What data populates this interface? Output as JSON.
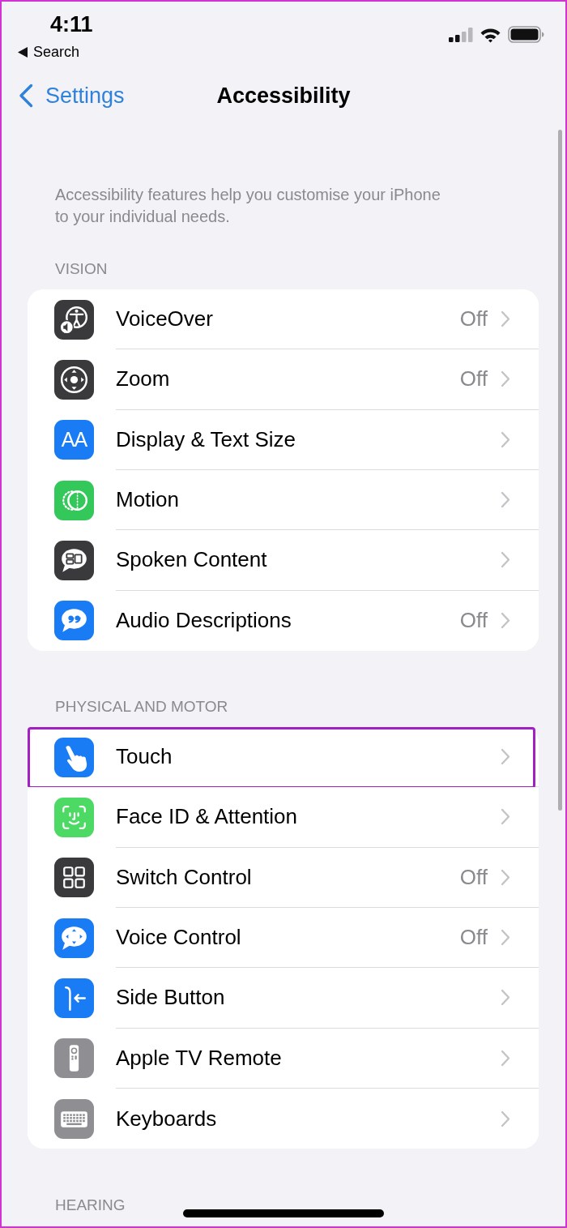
{
  "status_bar": {
    "time": "4:11",
    "back_app": "Search"
  },
  "nav_bar": {
    "back_label": "Settings",
    "title": "Accessibility"
  },
  "intro": "Accessibility features help you customise your iPhone\nto your individual needs.",
  "sections": [
    {
      "header": "VISION",
      "items": [
        {
          "label": "VoiceOver",
          "value": "Off",
          "color": "#3a3a3c",
          "highlighted": false
        },
        {
          "label": "Zoom",
          "value": "Off",
          "color": "#3a3a3c",
          "highlighted": false
        },
        {
          "label": "Display & Text Size",
          "icon_text": "AA",
          "color": "#1a7cf5",
          "highlighted": false
        },
        {
          "label": "Motion",
          "color": "#34c759",
          "highlighted": false
        },
        {
          "label": "Spoken Content",
          "color": "#3a3a3c",
          "highlighted": false
        },
        {
          "label": "Audio Descriptions",
          "value": "Off",
          "color": "#1a7cf5",
          "highlighted": false
        }
      ]
    },
    {
      "header": "PHYSICAL AND MOTOR",
      "items": [
        {
          "label": "Touch",
          "color": "#1a7cf5",
          "highlighted": true
        },
        {
          "label": "Face ID & Attention",
          "color": "#4cd964",
          "highlighted": false
        },
        {
          "label": "Switch Control",
          "value": "Off",
          "color": "#3a3a3c",
          "highlighted": false
        },
        {
          "label": "Voice Control",
          "value": "Off",
          "color": "#1a7cf5",
          "highlighted": false
        },
        {
          "label": "Side Button",
          "color": "#1a7cf5",
          "highlighted": false
        },
        {
          "label": "Apple TV Remote",
          "color": "#8e8e93",
          "highlighted": false
        },
        {
          "label": "Keyboards",
          "color": "#8e8e93",
          "highlighted": false
        }
      ]
    },
    {
      "header": "HEARING"
    }
  ]
}
